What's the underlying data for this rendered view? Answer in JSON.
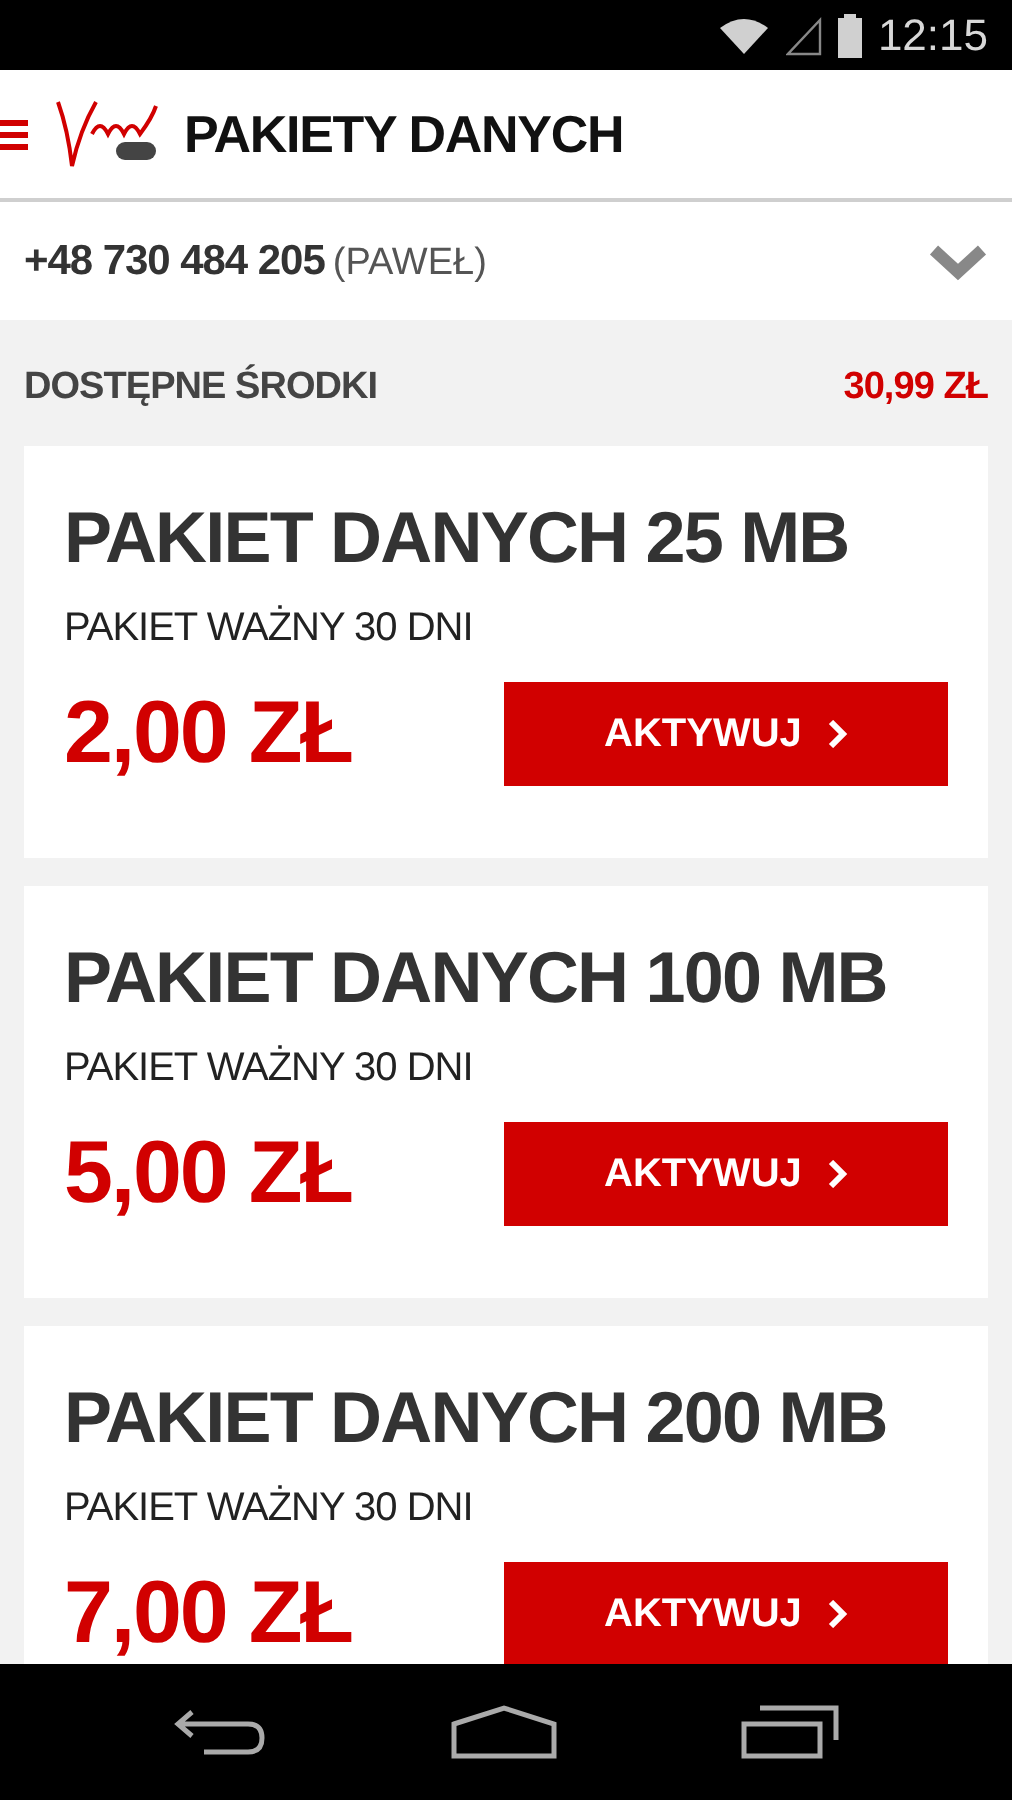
{
  "status_bar": {
    "time": "12:15"
  },
  "header": {
    "title": "PAKIETY DANYCH"
  },
  "account": {
    "number": "+48 730 484 205",
    "name": "(PAWEŁ)"
  },
  "balance": {
    "label": "DOSTĘPNE ŚRODKI",
    "amount": "30,99 ZŁ"
  },
  "packages": [
    {
      "title": "PAKIET DANYCH 25 MB",
      "validity": "PAKIET WAŻNY 30 DNI",
      "price": "2,00 ZŁ",
      "button": "AKTYWUJ"
    },
    {
      "title": "PAKIET DANYCH 100 MB",
      "validity": "PAKIET WAŻNY 30 DNI",
      "price": "5,00 ZŁ",
      "button": "AKTYWUJ"
    },
    {
      "title": "PAKIET DANYCH 200 MB",
      "validity": "PAKIET WAŻNY 30 DNI",
      "price": "7,00 ZŁ",
      "button": "AKTYWUJ"
    }
  ]
}
